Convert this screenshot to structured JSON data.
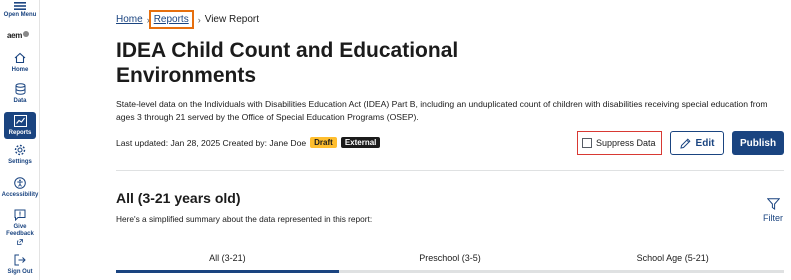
{
  "sidebar": {
    "open_menu": "Open Menu",
    "logo": "aem",
    "items": [
      {
        "label": "Home",
        "icon": "home-icon"
      },
      {
        "label": "Data",
        "icon": "database-icon"
      },
      {
        "label": "Reports",
        "icon": "chart-icon",
        "active": true
      },
      {
        "label": "Settings",
        "icon": "gear-icon"
      },
      {
        "label": "Accessibility",
        "icon": "accessibility-icon"
      },
      {
        "label": "Give Feedback",
        "icon": "feedback-icon"
      },
      {
        "label": "Sign Out",
        "icon": "sign-out-icon"
      }
    ]
  },
  "breadcrumb": {
    "home": "Home",
    "reports": "Reports",
    "current": "View Report",
    "separator": "›"
  },
  "report": {
    "title": "IDEA Child Count and Educational Environments",
    "description": "State-level data on the Individuals with Disabilities Education Act (IDEA) Part B, including an unduplicated count of children with disabilities receiving special education from ages 3 through 21 served by the Office of Special Education Programs (OSEP).",
    "meta_text": "Last updated: Jan 28, 2025 Created by: Jane Doe",
    "badge_draft": "Draft",
    "badge_external": "External"
  },
  "actions": {
    "suppress_label": "Suppress Data",
    "suppress_checked": false,
    "edit_label": "Edit",
    "publish_label": "Publish"
  },
  "section": {
    "title": "All (3-21 years old)",
    "subtitle": "Here's a simplified summary about the data represented in this report:",
    "filter_label": "Filter"
  },
  "tabs": [
    {
      "label": "All (3-21)",
      "active": true
    },
    {
      "label": "Preschool (3-5)",
      "active": false
    },
    {
      "label": "School Age (5-21)",
      "active": false
    }
  ],
  "colors": {
    "primary": "#1a4480",
    "draft": "#ffbe2e",
    "highlight_orange": "#e66f0e",
    "highlight_red": "#d83933"
  }
}
